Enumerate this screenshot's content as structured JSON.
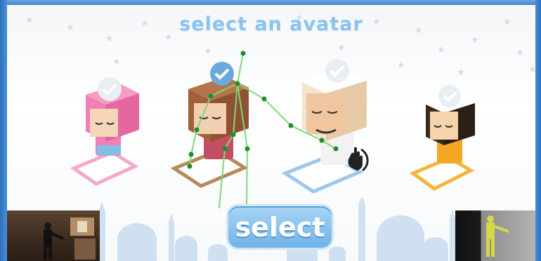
{
  "title": "select an avatar",
  "select_button": {
    "label": "select"
  },
  "avatars": [
    {
      "name": "girl-pink-avatar",
      "selected": true,
      "mat_color": "#f4a9c9",
      "body_color": "#f07fb6",
      "face_color": "#f6d6b8"
    },
    {
      "name": "girl-hijab-avatar",
      "selected": true,
      "mat_color": "#b78a5c",
      "body_color": "#c34e63",
      "face_color": "#f2cfb0",
      "hat_color": "#a15f3a"
    },
    {
      "name": "man-white-avatar",
      "selected": true,
      "mat_color": "#9cc8ec",
      "body_color": "#ffffff",
      "face_color": "#f0c69e",
      "hat_color": "#ffffff"
    },
    {
      "name": "boy-orange-avatar",
      "selected": true,
      "mat_color": "#f5b43a",
      "body_color": "#f5a623",
      "face_color": "#f6d2ad",
      "hat_color": "#ffffff"
    }
  ],
  "colors": {
    "accent": "#8dc3ec",
    "skeleton_line": "#7ed87a",
    "skeleton_joint": "#1e8f2a",
    "frame": "#3d7fc9"
  },
  "icons": [
    "checkmark-icon",
    "hand-cursor-icon"
  ]
}
